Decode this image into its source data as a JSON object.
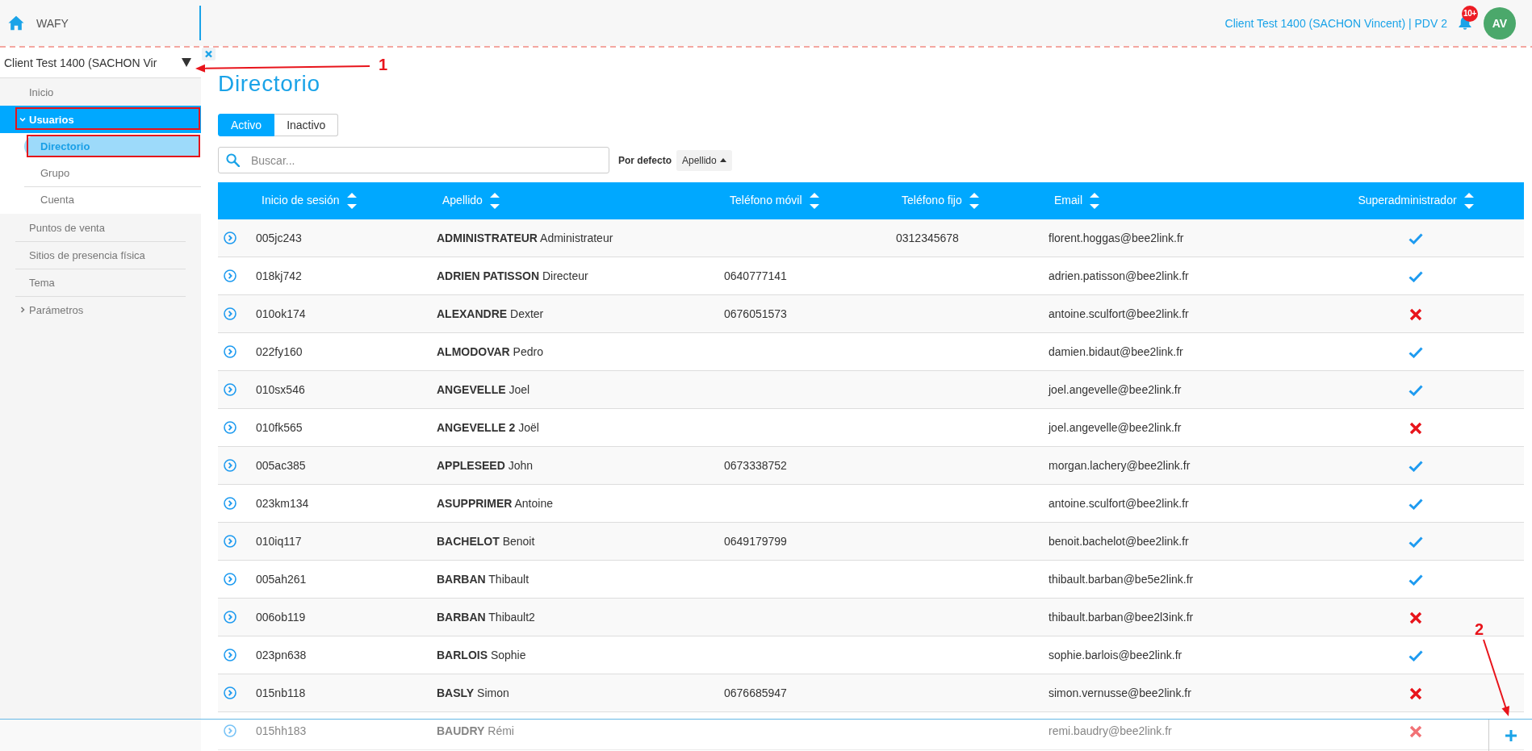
{
  "top_bar": {
    "app_name": "WAFY",
    "account": "Client Test 1400 (SACHON Vincent) | PDV 2",
    "notification_count": "10+",
    "avatar_initials": "AV"
  },
  "sidebar": {
    "client_select": "Client Test 1400 (SACHON Vir",
    "items": [
      {
        "label": "Inicio",
        "kind": "link",
        "selected": false,
        "outlined": false
      },
      {
        "label": "Usuarios",
        "kind": "group",
        "selected": true,
        "outlined": true,
        "expanded": true,
        "children": [
          {
            "label": "Directorio",
            "selected": true,
            "outlined": true
          },
          {
            "label": "Grupo",
            "selected": false,
            "outlined": false
          },
          {
            "label": "Cuenta",
            "selected": false,
            "outlined": false
          }
        ]
      },
      {
        "label": "Puntos de venta",
        "kind": "link",
        "selected": false,
        "outlined": false
      },
      {
        "label": "Sitios de presencia física",
        "kind": "link",
        "selected": false,
        "outlined": false
      },
      {
        "label": "Tema",
        "kind": "link",
        "selected": false,
        "outlined": false
      },
      {
        "label": "Parámetros",
        "kind": "group",
        "selected": false,
        "outlined": false,
        "expanded": false
      }
    ]
  },
  "main": {
    "title": "Directorio",
    "tabs": [
      {
        "label": "Activo",
        "selected": true
      },
      {
        "label": "Inactivo",
        "selected": false
      }
    ],
    "search": {
      "placeholder": "Buscar..."
    },
    "sort": {
      "label": "Por defecto",
      "field": "Apellido",
      "ascending": true
    },
    "table": {
      "columns": [
        "Inicio de sesión",
        "Apellido",
        "Teléfono móvil",
        "Teléfono fijo",
        "Email",
        "Superadministrador"
      ],
      "rows": [
        {
          "login": "005jc243",
          "name": "**ADMINISTRATEUR** Administrateur",
          "landline": "0312345678",
          "email": "florent.hoggas@bee2link.fr",
          "superadmin": true
        },
        {
          "login": "018kj742",
          "name": "**ADRIEN PATISSON** Directeur",
          "mobile": "0640777141",
          "email": "adrien.patisson@bee2link.fr",
          "superadmin": true
        },
        {
          "login": "010ok174",
          "name": "**ALEXANDRE** Dexter",
          "mobile": "0676051573",
          "email": "antoine.sculfort@bee2link.fr",
          "superadmin": false
        },
        {
          "login": "022fy160",
          "name": "**ALMODOVAR** Pedro",
          "email": "damien.bidaut@bee2link.fr",
          "superadmin": true
        },
        {
          "login": "010sx546",
          "name": "**ANGEVELLE** Joel",
          "email": "joel.angevelle@bee2link.fr",
          "superadmin": true
        },
        {
          "login": "010fk565",
          "name": "**ANGEVELLE 2** Joël",
          "email": "joel.angevelle@bee2link.fr",
          "superadmin": false
        },
        {
          "login": "005ac385",
          "name": "**APPLESEED** John",
          "mobile": "0673338752",
          "email": "morgan.lachery@bee2link.fr",
          "superadmin": true
        },
        {
          "login": "023km134",
          "name": "**ASUPPRIMER** Antoine",
          "email": "antoine.sculfort@bee2link.fr",
          "superadmin": true
        },
        {
          "login": "010iq117",
          "name": "**BACHELOT** Benoit",
          "mobile": "0649179799",
          "email": "benoit.bachelot@bee2link.fr",
          "superadmin": true
        },
        {
          "login": "005ah261",
          "name": "**BARBAN** Thibault",
          "email": "thibault.barban@be5e2link.fr",
          "superadmin": true
        },
        {
          "login": "006ob119",
          "name": "**BARBAN** Thibault2",
          "email": "thibault.barban@bee2l3ink.fr",
          "superadmin": false
        },
        {
          "login": "023pn638",
          "name": "**BARLOIS** Sophie",
          "email": "sophie.barlois@bee2link.fr",
          "superadmin": true
        },
        {
          "login": "015nb118",
          "name": "**BASLY** Simon",
          "mobile": "0676685947",
          "email": "simon.vernusse@bee2link.fr",
          "superadmin": false
        },
        {
          "login": "015hh183",
          "name": "**BAUDRY** Rémi",
          "email": "remi.baudry@bee2link.fr",
          "superadmin": false
        }
      ]
    }
  },
  "annotations": [
    {
      "label": "1"
    },
    {
      "label": "2"
    }
  ]
}
